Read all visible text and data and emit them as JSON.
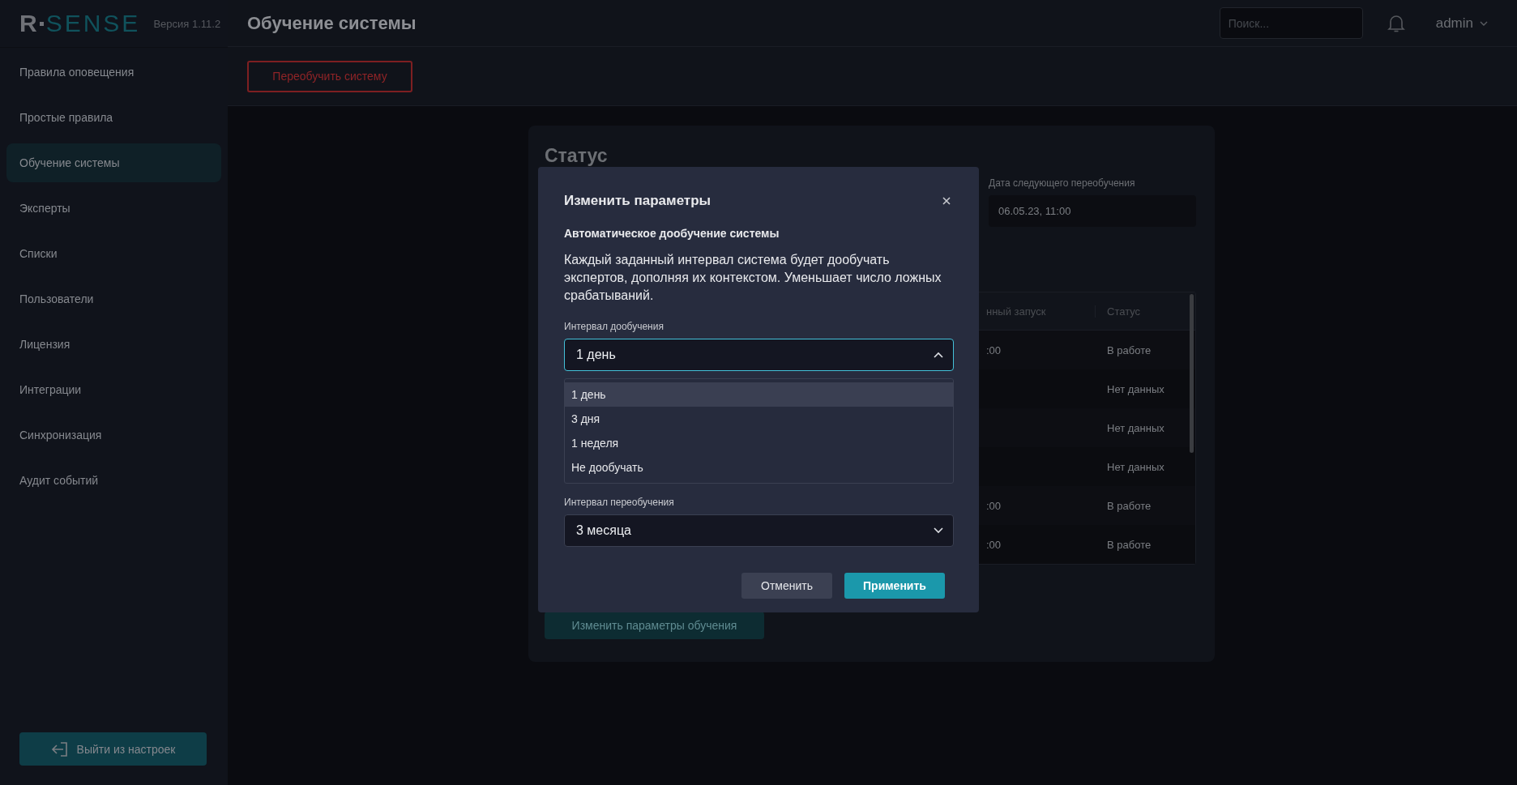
{
  "sidebar": {
    "logo": {
      "mark": "R",
      "word": "SENSE"
    },
    "version": "Версия 1.11.2",
    "items": [
      {
        "label": "Правила оповещения",
        "selected": false
      },
      {
        "label": "Простые правила",
        "selected": false
      },
      {
        "label": "Обучение системы",
        "selected": true
      },
      {
        "label": "Эксперты",
        "selected": false
      },
      {
        "label": "Списки",
        "selected": false
      },
      {
        "label": "Пользователи",
        "selected": false
      },
      {
        "label": "Лицензия",
        "selected": false
      },
      {
        "label": "Интеграции",
        "selected": false
      },
      {
        "label": "Синхронизация",
        "selected": false
      },
      {
        "label": "Аудит событий",
        "selected": false
      }
    ],
    "exit_button": "Выйти из настроек"
  },
  "header": {
    "title": "Обучение системы",
    "search": {
      "placeholder": "Поиск..."
    },
    "user": "admin"
  },
  "toolbar": {
    "retrain_button": "Переобучить систему"
  },
  "status_card": {
    "title": "Статус",
    "next_retrain": {
      "label": "Дата следующего переобучения",
      "value": "06.05.23, 11:00"
    },
    "table": {
      "columns": [
        "нный запуск",
        "Статус"
      ],
      "rows": [
        {
          "column_1": ":00",
          "status": "В работе"
        },
        {
          "status": "Нет данных"
        },
        {
          "status": "Нет данных"
        },
        {
          "status": "Нет данных"
        },
        {
          "column_1": ":00",
          "status": "В работе"
        },
        {
          "column_1": ":00",
          "status": "В работе"
        }
      ]
    },
    "edit_button": "Изменить параметры обучения"
  },
  "modal": {
    "title": "Изменить параметры",
    "section_title": "Автоматическое дообучение системы",
    "description": "Каждый заданный интервал система будет дообучать экспертов, дополняя их контекстом. Уменьшает число ложных срабатываний.",
    "fields": [
      {
        "label": "Интервал дообучения",
        "value": "1 день",
        "expanded": true,
        "options": [
          {
            "label": "1 день",
            "selected": true
          },
          {
            "label": "3 дня",
            "selected": false
          },
          {
            "label": "1 неделя",
            "selected": false
          },
          {
            "label": "Не дообучать",
            "selected": false
          }
        ]
      },
      {
        "label": "Интервал переобучения",
        "value": "3 месяца",
        "expanded": false
      }
    ],
    "buttons": [
      {
        "label": "Отменить",
        "kind": "secondary"
      },
      {
        "label": "Применить",
        "kind": "primary"
      }
    ]
  }
}
